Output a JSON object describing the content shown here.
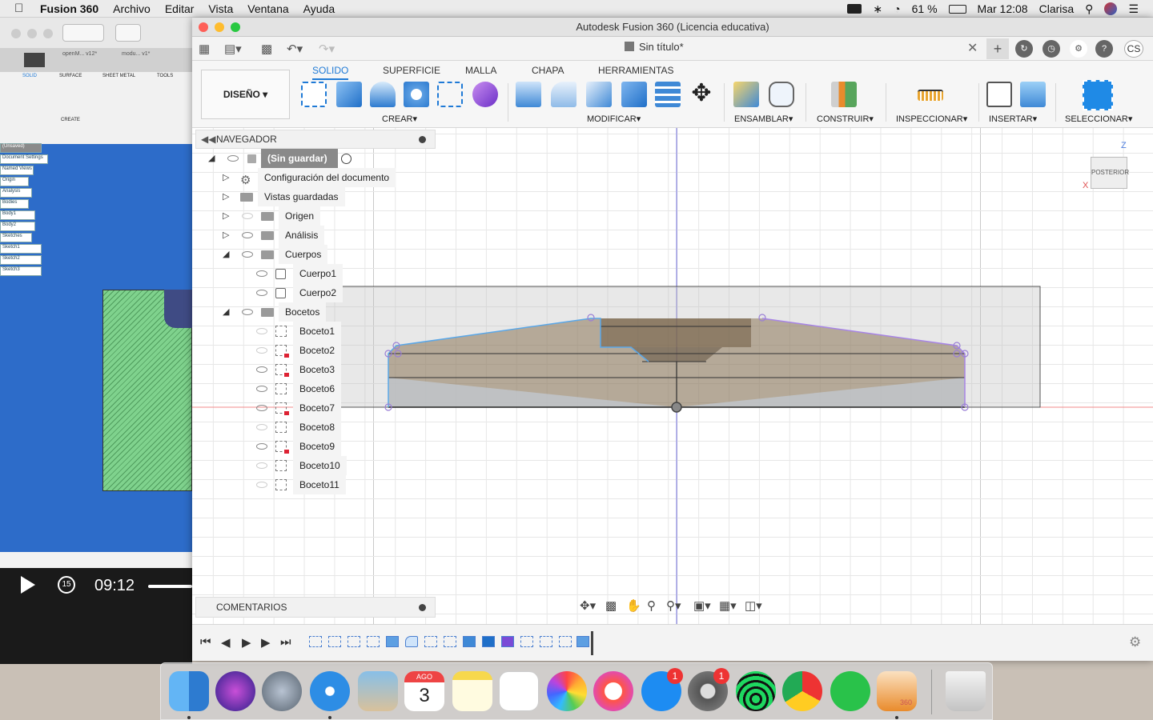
{
  "menubar": {
    "app_name": "Fusion 360",
    "items": [
      "Archivo",
      "Editar",
      "Vista",
      "Ventana",
      "Ayuda"
    ],
    "battery": "61 %",
    "clock": "Mar 12:08",
    "user": "Clarisa"
  },
  "background_video": {
    "time": "09:12",
    "skip_label": "15",
    "mini_tabs": [
      "SOLID",
      "SURFACE",
      "SHEET METAL",
      "TOOLS"
    ],
    "mini_tab_files": [
      "openM... v12*",
      "modu... v1*"
    ],
    "mini_create": "CREATE",
    "mini_nav": [
      "(Unsaved)",
      "Document Settings",
      "Named Views",
      "Origin",
      "Analysis",
      "Bodies",
      "Body1",
      "Body2",
      "Sketches",
      "Sketch1",
      "Sketch2",
      "Sketch3"
    ]
  },
  "window": {
    "title": "Autodesk Fusion 360 (Licencia educativa)",
    "doc_tab": "Sin título*",
    "avatar": "CS"
  },
  "ribbon": {
    "workspace": "DISEÑO",
    "tabs": [
      "SOLIDO",
      "SUPERFICIE",
      "MALLA",
      "CHAPA",
      "HERRAMIENTAS"
    ],
    "active_tab": "SOLIDO",
    "groups": [
      "CREAR",
      "MODIFICAR",
      "ENSAMBLAR",
      "CONSTRUIR",
      "INSPECCIONAR",
      "INSERTAR",
      "SELECCIONAR"
    ],
    "accent": "#1f7ad6"
  },
  "navigator": {
    "title": "NAVEGADOR",
    "root": "(Sin guardar)",
    "items": [
      {
        "label": "Configuración del documento"
      },
      {
        "label": "Vistas guardadas"
      },
      {
        "label": "Origen"
      },
      {
        "label": "Análisis"
      },
      {
        "label": "Cuerpos"
      },
      {
        "label": "Cuerpo1"
      },
      {
        "label": "Cuerpo2"
      },
      {
        "label": "Bocetos"
      },
      {
        "label": "Boceto1"
      },
      {
        "label": "Boceto2"
      },
      {
        "label": "Boceto3"
      },
      {
        "label": "Boceto6"
      },
      {
        "label": "Boceto7"
      },
      {
        "label": "Boceto8"
      },
      {
        "label": "Boceto9"
      },
      {
        "label": "Boceto10"
      },
      {
        "label": "Boceto11"
      }
    ]
  },
  "comments": {
    "title": "COMENTARIOS"
  },
  "viewcube": {
    "face": "POSTERIOR",
    "axis_z": "Z",
    "axis_x": "X"
  },
  "dock": {
    "calendar_month": "AGO",
    "calendar_day": "3",
    "appstore_badge": "1",
    "prefs_badge": "1",
    "fusion_label": "360"
  }
}
